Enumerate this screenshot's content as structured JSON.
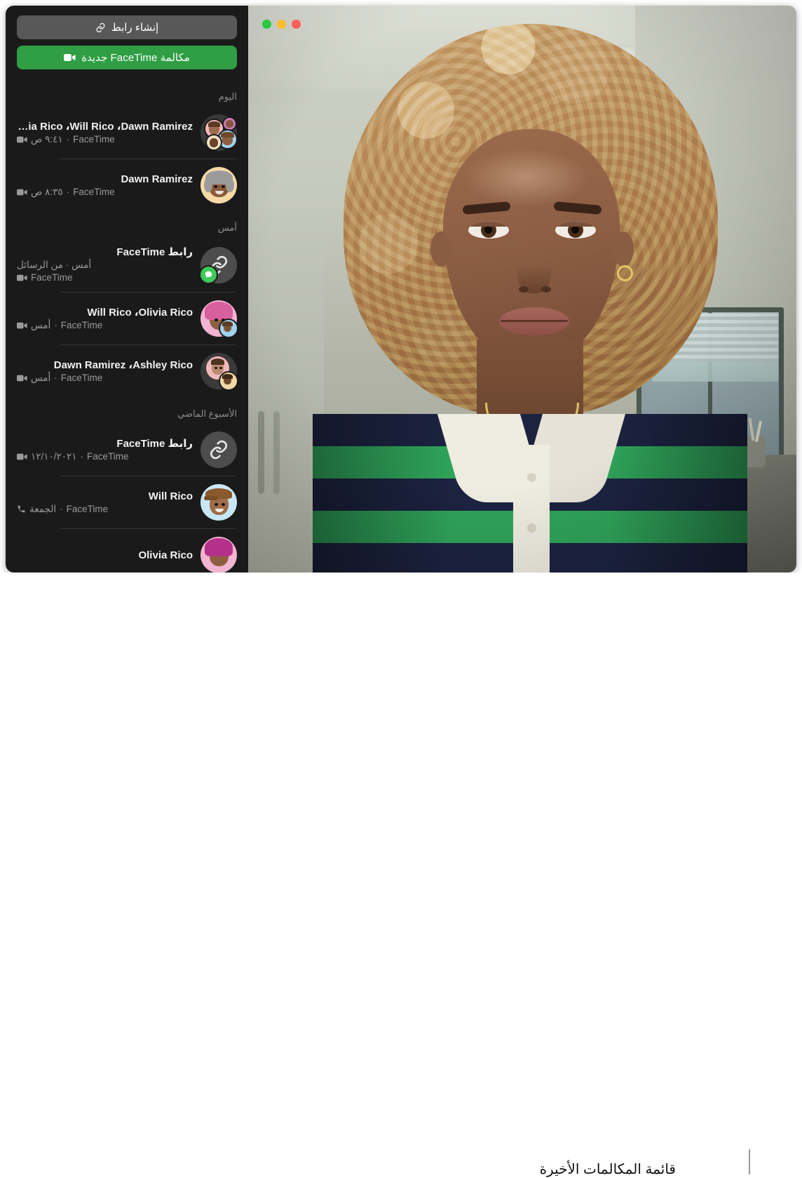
{
  "window": {
    "traffic_lights": [
      "close",
      "minimize",
      "zoom"
    ]
  },
  "sidebar": {
    "buttons": [
      {
        "name": "create-link-button",
        "label": "إنشاء رابط",
        "icon": "link-icon",
        "style": "gray"
      },
      {
        "name": "new-facetime-button",
        "label": "مكالمة FaceTime جديدة",
        "icon": "video-camera-icon",
        "style": "green"
      }
    ],
    "sections": [
      {
        "header": "اليوم",
        "rows": [
          {
            "title": "Olivia Rico ،Will Rico ،Dawn Ramirez",
            "service": "FaceTime",
            "separator": "·",
            "time": "٩:٤١ ص",
            "call_type_icon": "video-camera-icon",
            "avatar": "group-cluster"
          },
          {
            "title": "Dawn Ramirez",
            "service": "FaceTime",
            "separator": "·",
            "time": "٨:٣٥ ص",
            "call_type_icon": "video-camera-icon",
            "avatar": "memoji-dawn"
          }
        ]
      },
      {
        "header": "أمس",
        "rows": [
          {
            "title": "رابط FaceTime",
            "line2": "أمس · من الرسائل",
            "service": "FaceTime",
            "call_type_icon": "video-camera-icon",
            "avatar": "link-icon",
            "badge": "messages-badge"
          },
          {
            "title": "Will Rico ،Olivia Rico",
            "service": "FaceTime",
            "separator": "·",
            "time": "أمس",
            "call_type_icon": "video-camera-icon",
            "avatar": "memoji-pair-olivia"
          },
          {
            "title": "Dawn Ramirez ،Ashley Rico",
            "service": "FaceTime",
            "separator": "·",
            "time": "أمس",
            "call_type_icon": "video-camera-icon",
            "avatar": "memoji-pair-ashley"
          }
        ]
      },
      {
        "header": "الأسبوع الماضي",
        "rows": [
          {
            "title": "رابط FaceTime",
            "service": "FaceTime",
            "separator": "·",
            "time": "١٢/١٠/٢٠٢١",
            "call_type_icon": "video-camera-icon",
            "avatar": "link-icon"
          },
          {
            "title": "Will Rico",
            "service": "FaceTime",
            "separator": "·",
            "time": "الجمعة",
            "call_type_icon": "phone-icon",
            "avatar": "memoji-will"
          },
          {
            "title": "Olivia Rico",
            "service": "",
            "separator": "",
            "time": "",
            "call_type_icon": "",
            "avatar": "memoji-olivia"
          }
        ]
      }
    ]
  },
  "callout": {
    "text": "قائمة المكالمات الأخيرة"
  },
  "colors": {
    "sidebar_bg": "#1a1a1a",
    "green_button": "#2f9e44",
    "gray_button": "#585858",
    "title_text": "#f2f2f2",
    "sub_text": "#9a9a9a",
    "section_header": "#8e8e8e",
    "separator": "#343434",
    "badge_green": "#3ec95a"
  }
}
